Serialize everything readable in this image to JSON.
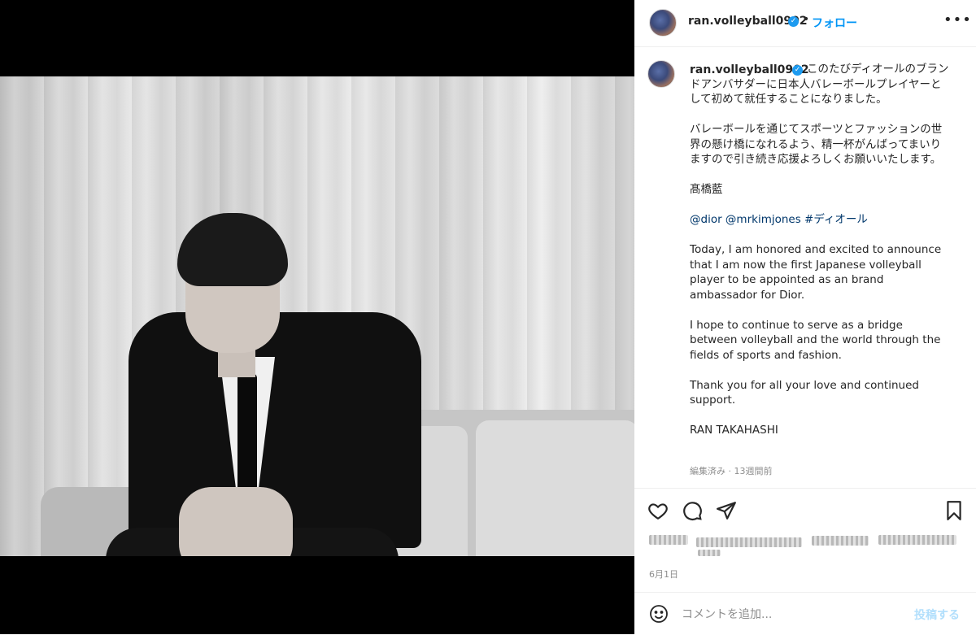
{
  "post": {
    "username": "ran.volleyball0902",
    "follow_label": "フォロー",
    "more_label": "•••",
    "caption_lead": "ran.volleyball0902",
    "caption_text": "このたびディオールのブランドアンバサダーに日本人バレーボールプレイヤーとして初めて就任することになりました。\n\nバレーボールを通じてスポーツとファッションの世界の懸け橋になれるよう、精一杯がんばってまいりますので引き続き応援よろしくお願いいたします。\n\n髙橋藍\n\n",
    "caption_tags": "@dior @mrkimjones #ディオール",
    "caption_english": "\n\nToday, I am honored and excited to announce that I am now the first Japanese volleyball player to be appointed as an brand ambassador for Dior.\n\nI hope to continue to serve as a bridge between volleyball and the world through the fields of sports and fashion.\n\nThank you for all your love and continued support.\n\nRAN TAKAHASHI",
    "meta": "編集済み · 13週間前",
    "date": "6月1日"
  },
  "actions": {
    "icons": [
      "heart-icon",
      "comment-icon",
      "share-icon",
      "bookmark-icon"
    ]
  },
  "comment": {
    "placeholder": "コメントを追加...",
    "post_label": "投稿する"
  }
}
